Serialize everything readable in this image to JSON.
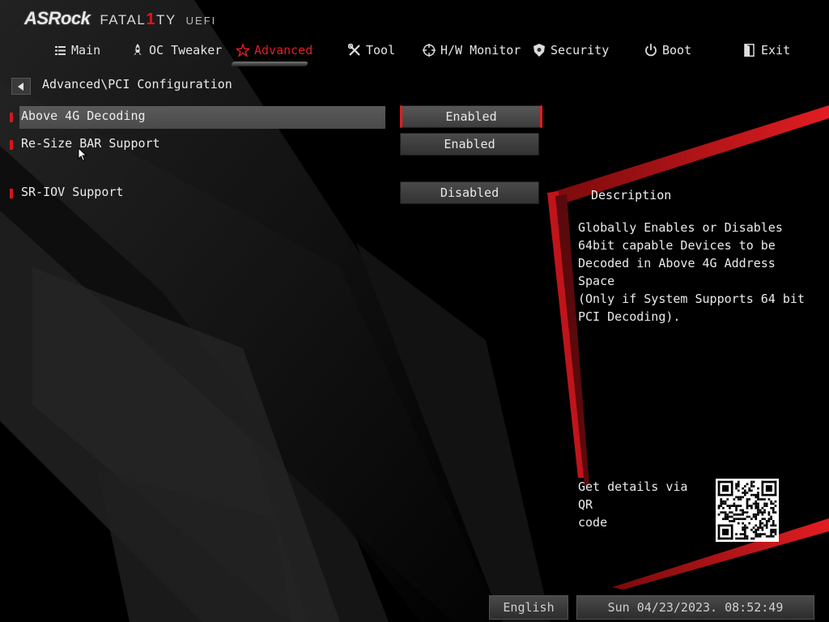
{
  "brand": {
    "name": "ASRock",
    "series": "FATAL1TY",
    "series_accent": "1",
    "firmware": "UEFI"
  },
  "nav": {
    "tabs": [
      {
        "label": "Main",
        "icon": "list-icon"
      },
      {
        "label": "OC Tweaker",
        "icon": "rocket-icon"
      },
      {
        "label": "Advanced",
        "icon": "star-icon",
        "active": true
      },
      {
        "label": "Tool",
        "icon": "tools-icon"
      },
      {
        "label": "H/W Monitor",
        "icon": "crosshair-icon"
      },
      {
        "label": "Security",
        "icon": "shield-icon"
      },
      {
        "label": "Boot",
        "icon": "power-icon"
      },
      {
        "label": "Exit",
        "icon": "exit-door-icon"
      }
    ]
  },
  "breadcrumb": {
    "path": "Advanced\\PCI Configuration"
  },
  "settings": [
    {
      "label": "Above 4G Decoding",
      "value": "Enabled",
      "selected": true
    },
    {
      "label": "Re-Size BAR Support",
      "value": "Enabled",
      "selected": false
    },
    {
      "label": "SR-IOV Support",
      "value": "Disabled",
      "selected": false
    }
  ],
  "description": {
    "title": "Description",
    "lines": [
      "Globally Enables or Disables",
      "64bit capable Devices to be",
      "Decoded in Above 4G Address Space",
      "(Only if System Supports 64 bit",
      "PCI Decoding)."
    ],
    "qr_lines": [
      "Get details via QR",
      "code"
    ]
  },
  "footer": {
    "language": "English",
    "datetime": "Sun 04/23/2023. 08:52:49"
  },
  "colors": {
    "accent": "#e11d22",
    "background": "#000000",
    "text": "#f0f0f0"
  }
}
